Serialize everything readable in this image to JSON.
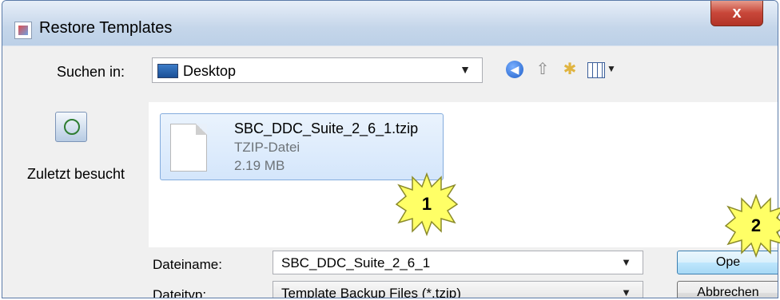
{
  "window": {
    "title": "Restore Templates",
    "close_label": "x"
  },
  "lookin": {
    "label": "Suchen in:",
    "value": "Desktop"
  },
  "places": [
    {
      "label": "Zuletzt besucht"
    }
  ],
  "files": [
    {
      "name": "SBC_DDC_Suite_2_6_1.tzip",
      "type": "TZIP-Datei",
      "size": "2.19 MB"
    }
  ],
  "filename": {
    "label": "Dateiname:",
    "value": "SBC_DDC_Suite_2_6_1"
  },
  "filetype": {
    "label": "Dateityp:",
    "value": "Template Backup Files (*.tzip)"
  },
  "buttons": {
    "open": "Ope",
    "cancel": "Abbrechen"
  },
  "callouts": [
    "1",
    "2"
  ],
  "colors": {
    "callout_fill": "#ffff66",
    "callout_stroke": "#8a8a2a",
    "selection": "#d4e6fb",
    "close_button": "#c8473a"
  }
}
